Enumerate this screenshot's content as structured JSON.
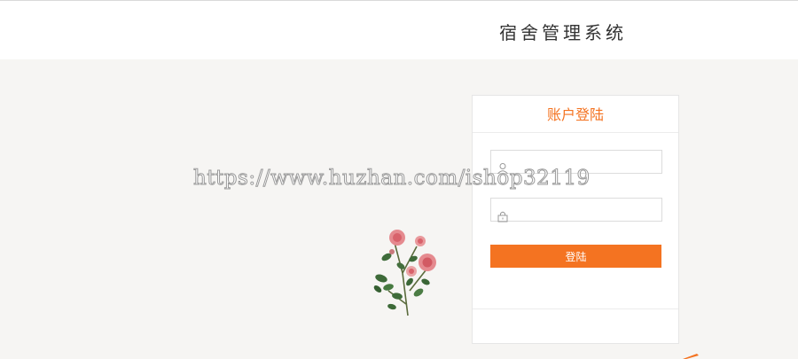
{
  "header": {
    "title": "宿舍管理系统"
  },
  "watermark": {
    "text": "https://www.huzhan.com/ishop32119"
  },
  "login": {
    "title": "账户登陆",
    "username_placeholder": "",
    "password_placeholder": "",
    "submit_label": "登陆"
  },
  "colors": {
    "accent": "#f47321",
    "background": "#f6f5f3"
  },
  "icons": {
    "username": "user-icon",
    "password": "lock-icon"
  }
}
